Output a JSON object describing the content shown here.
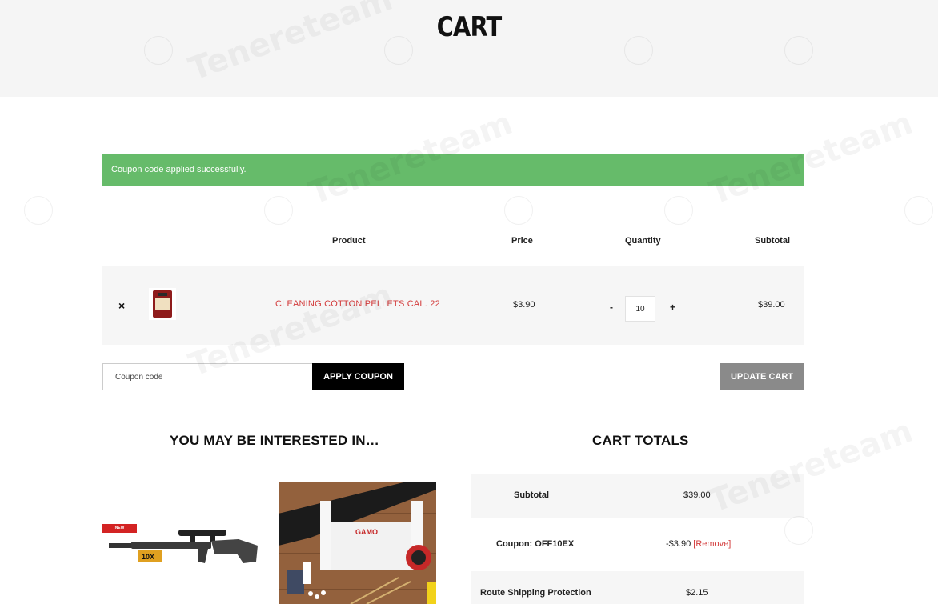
{
  "page": {
    "title": "CART"
  },
  "notice": {
    "message": "Coupon code applied successfully."
  },
  "cart_table": {
    "headers": {
      "product": "Product",
      "price": "Price",
      "quantity": "Quantity",
      "subtotal": "Subtotal"
    },
    "items": [
      {
        "name": "CLEANING COTTON PELLETS CAL. 22",
        "price": "$3.90",
        "quantity": "10",
        "subtotal": "$39.00",
        "remove_symbol": "×"
      }
    ],
    "qty_minus": "-",
    "qty_plus": "+"
  },
  "coupon": {
    "placeholder": "Coupon code",
    "apply_label": "APPLY COUPON"
  },
  "update_label": "UPDATE CART",
  "interested": {
    "title": "YOU MAY BE INTERESTED IN…",
    "badge": "NEW",
    "badge_color": "#d32323"
  },
  "totals": {
    "title": "CART TOTALS",
    "rows": [
      {
        "label": "Subtotal",
        "value": "$39.00"
      },
      {
        "label": "Coupon: OFF10EX",
        "value": "-$3.90",
        "link": "[Remove]"
      },
      {
        "label": "Route Shipping Protection",
        "value": "$2.15"
      }
    ]
  },
  "watermark": {
    "text": "Tenereteam"
  },
  "colors": {
    "success": "#66bb6a",
    "accent_red": "#d33b3b",
    "dark_button": "#000000",
    "gray_button": "#8a8a8a"
  }
}
